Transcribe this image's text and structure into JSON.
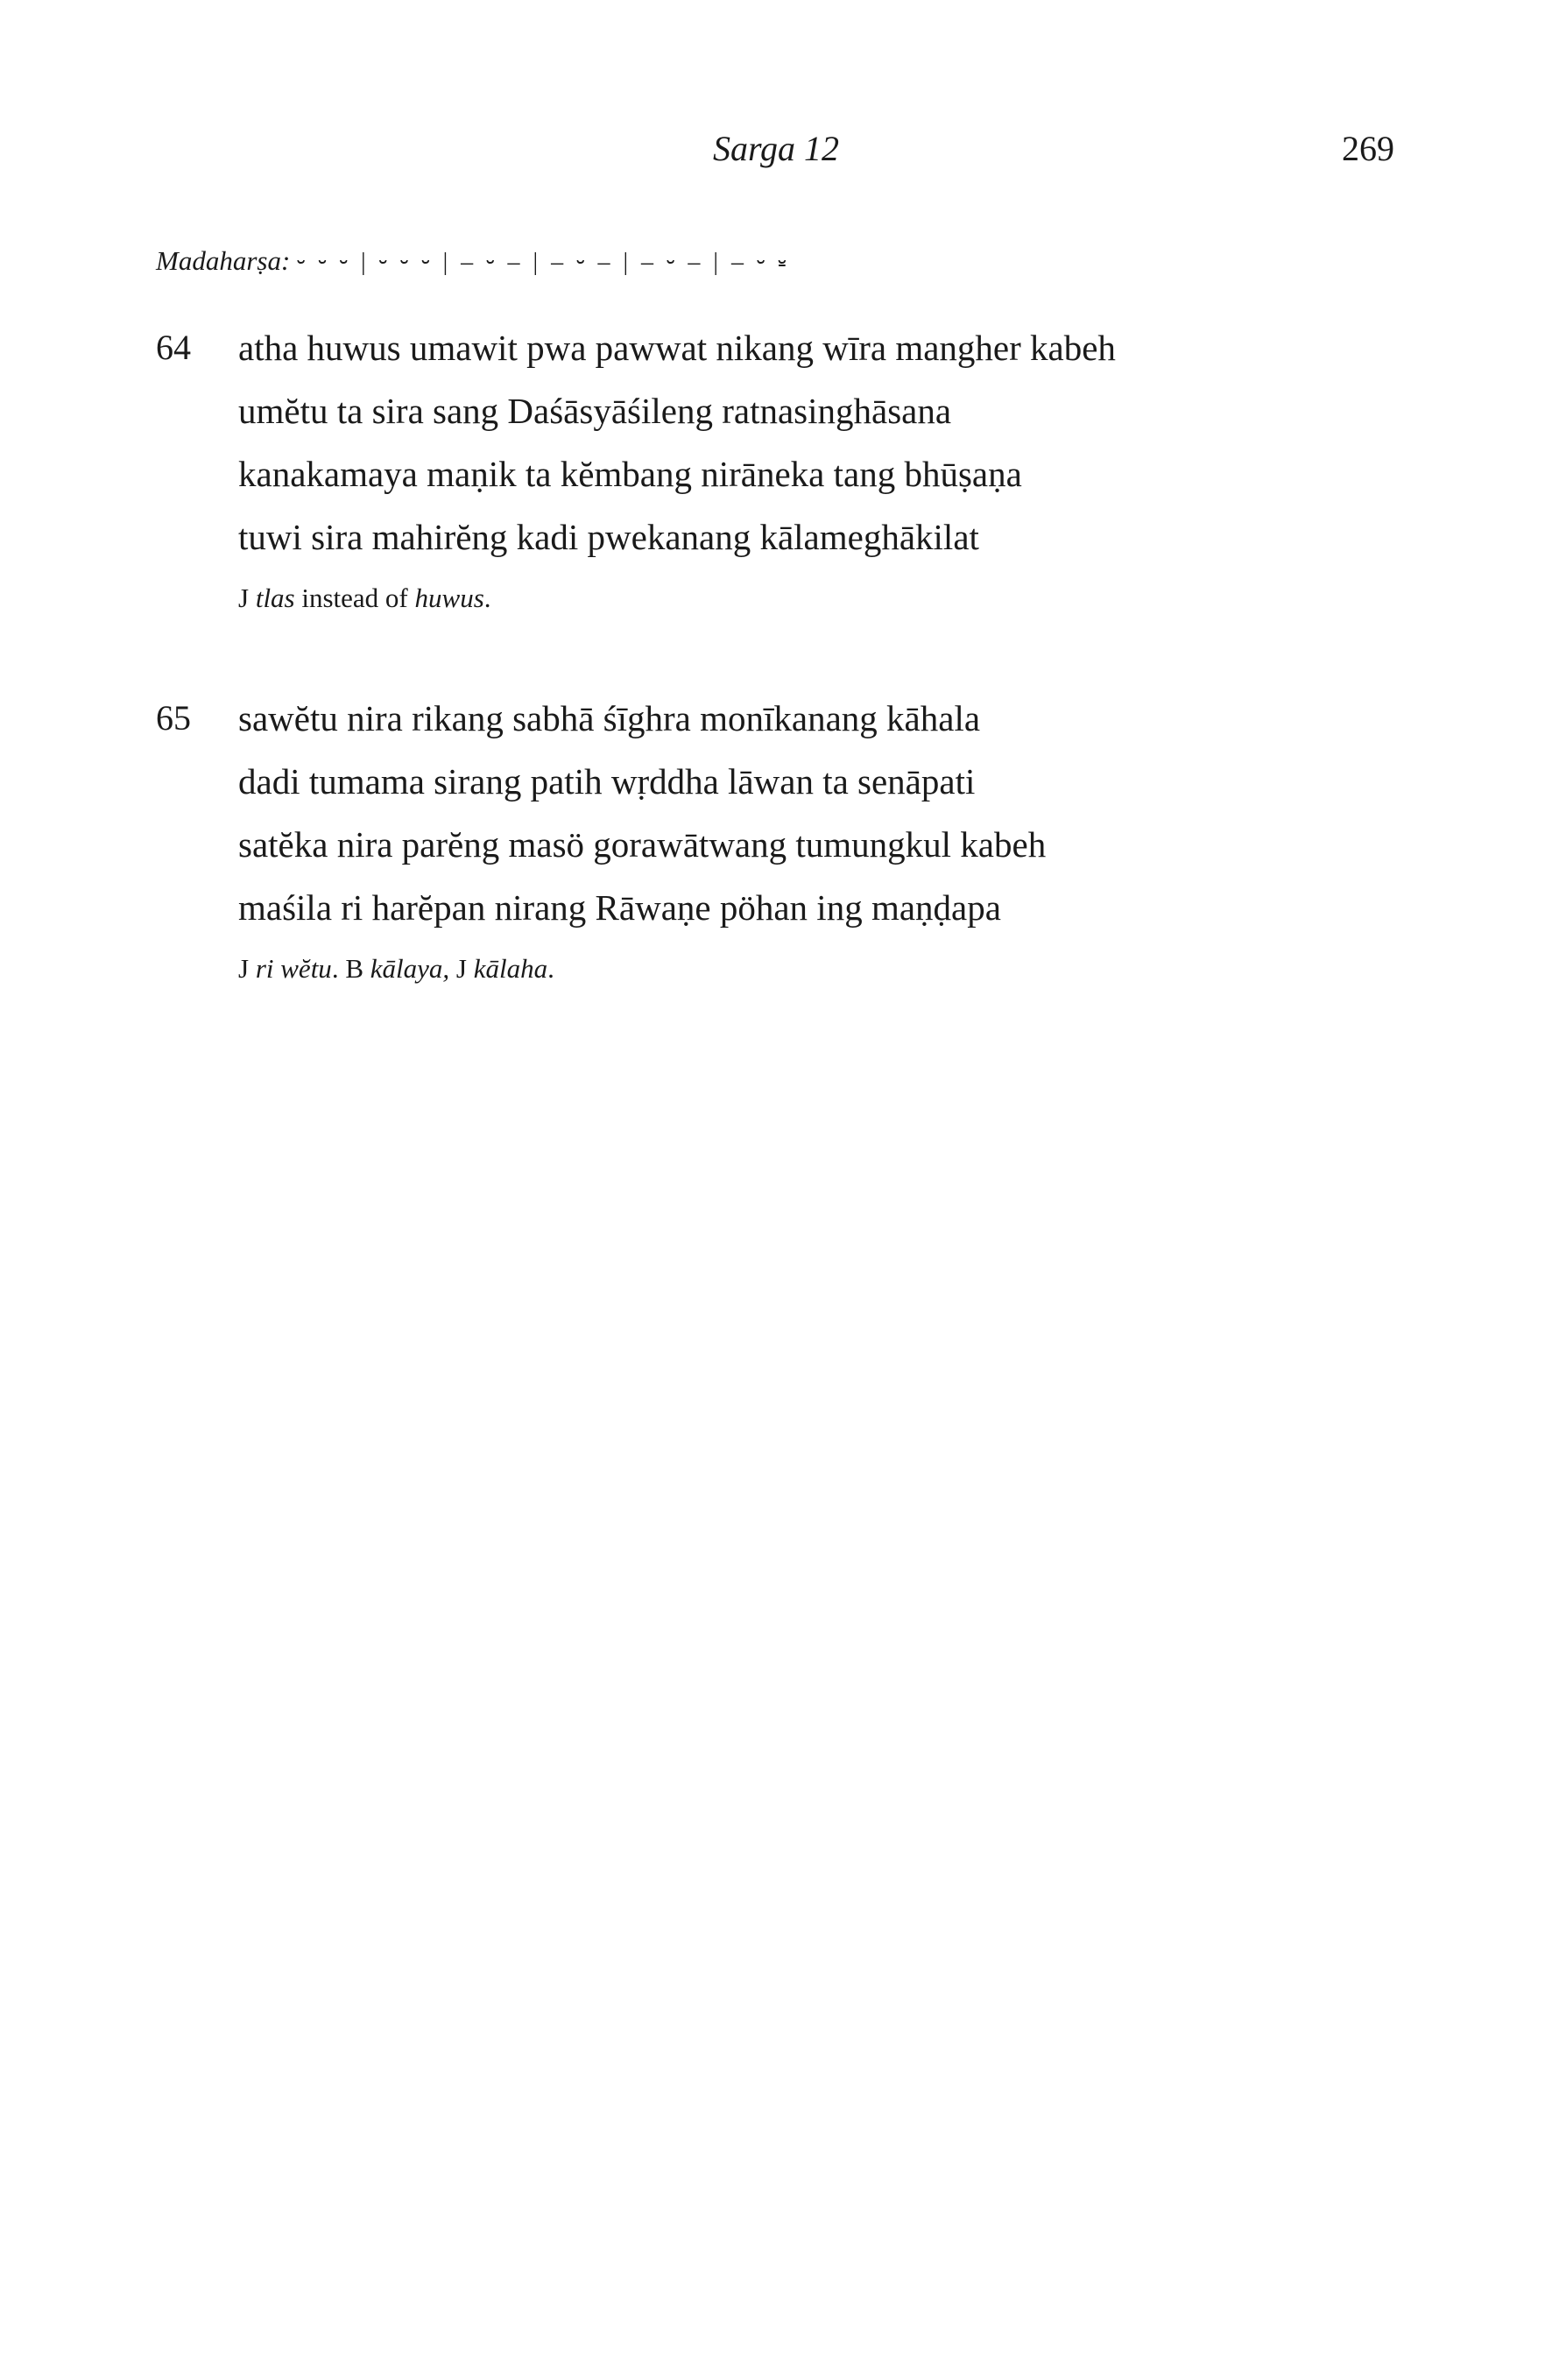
{
  "header": {
    "running_title": "Sarga 12",
    "page_number": "269"
  },
  "meter": {
    "name": "Madaharṣa:",
    "scheme": "⏑ ⏑ ⏑ | ⏑ ⏑ ⏑ | – ⏑ – | – ⏑ – | – ⏑ – | – ⏑ ⏓"
  },
  "stanzas": [
    {
      "number": "64",
      "lines": [
        "atha huwus umawit pwa pawwat nikang wīra mangher kabeh",
        "umĕtu ta sira sang Daśāsyāśileng ratnasinghāsana",
        "kanakamaya maṇik ta kĕmbang nirāneka tang bhūṣaṇa",
        "tuwi sira mahirĕng kadi pwekanang kālameghākilat"
      ],
      "note": {
        "part1": "J ",
        "part2": "tlas",
        "part3": " instead of ",
        "part4": "huwus",
        "part5": "."
      }
    },
    {
      "number": "65",
      "lines": [
        "sawĕtu nira rikang sabhā śīghra monīkanang kāhala",
        "dadi tumama sirang patih wṛddha lāwan ta senāpati",
        "satĕka nira parĕng masö gorawātwang tumungkul kabeh",
        "maśila ri harĕpan nirang Rāwaṇe pöhan ing maṇḍapa"
      ],
      "note": {
        "part1": "J ",
        "part2": "ri wĕtu",
        "part3": ". B ",
        "part4": "kālaya,",
        "part5": " J ",
        "part6": "kālaha",
        "part7": "."
      }
    }
  ]
}
